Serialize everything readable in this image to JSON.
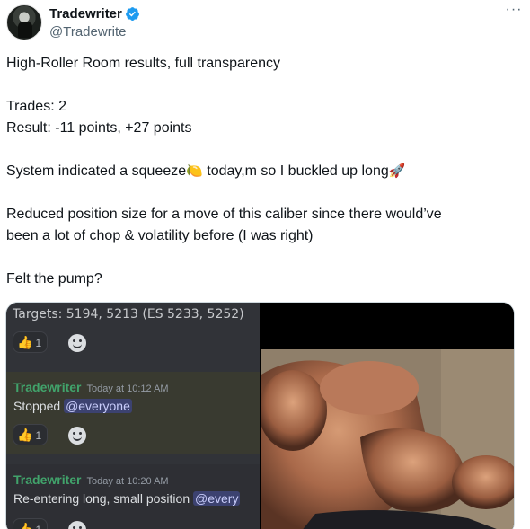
{
  "author": {
    "display_name": "Tradewriter",
    "handle": "@Tradewrite",
    "more_label": "···"
  },
  "tweet": {
    "lines": [
      "High-Roller Room results, full transparency",
      "",
      "Trades: 2",
      "Result: -11 points, +27 points",
      "",
      "System indicated a squeeze",
      "",
      "Reduced position size for a move of this caliber since there would’ve",
      "been a lot of chop & volatility before (I was right)",
      "",
      "Felt the pump?"
    ],
    "squeeze_emoji": "🍋",
    "squeeze_after": " today,m so I buckled up long",
    "rocket_emoji": "🚀"
  },
  "discord": {
    "targets": "Targets: 5194, 5213 (ES 5233, 5252)",
    "reaction_count": "1",
    "thumb_emoji": "👍",
    "messages": [
      {
        "author": "Tradewriter",
        "time": "Today at 10:12 AM",
        "text": "Stopped",
        "mention": "@everyone",
        "reaction_count": "1"
      },
      {
        "author": "Tradewriter",
        "time": "Today at 10:20 AM",
        "text": "Re-entering long, small position",
        "mention": "@every",
        "reaction_count": "1"
      }
    ]
  },
  "colors": {
    "discord_bg": "#313338",
    "author_green": "#41a36b",
    "verified_blue": "#1d9bf0"
  },
  "icons": [
    "verified-badge-icon",
    "more-options-icon",
    "thumbs-up-icon",
    "add-reaction-icon"
  ]
}
